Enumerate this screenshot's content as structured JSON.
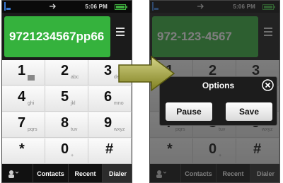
{
  "status": {
    "time": "5:06 PM"
  },
  "left": {
    "dialed_number": "9721234567pp66",
    "keys": [
      {
        "digit": "1",
        "sub": ""
      },
      {
        "digit": "2",
        "sub": "abc"
      },
      {
        "digit": "3",
        "sub": "def"
      },
      {
        "digit": "4",
        "sub": "ghi"
      },
      {
        "digit": "5",
        "sub": "jkl"
      },
      {
        "digit": "6",
        "sub": "mno"
      },
      {
        "digit": "7",
        "sub": "pqrs"
      },
      {
        "digit": "8",
        "sub": "tuv"
      },
      {
        "digit": "9",
        "sub": "wxyz"
      },
      {
        "digit": "*",
        "sub": ""
      },
      {
        "digit": "0",
        "sub": "+"
      },
      {
        "digit": "#",
        "sub": ""
      }
    ]
  },
  "right": {
    "dialed_number": "972-123-4567",
    "dialog": {
      "title": "Options",
      "pause_label": "Pause",
      "save_label": "Save"
    }
  },
  "tabs": {
    "contacts": "Contacts",
    "recent": "Recent",
    "dialer": "Dialer"
  },
  "colors": {
    "accent_green": "#35b23d",
    "arrow_olive": "#7f7f1f",
    "arrow_light": "#d4d488"
  }
}
